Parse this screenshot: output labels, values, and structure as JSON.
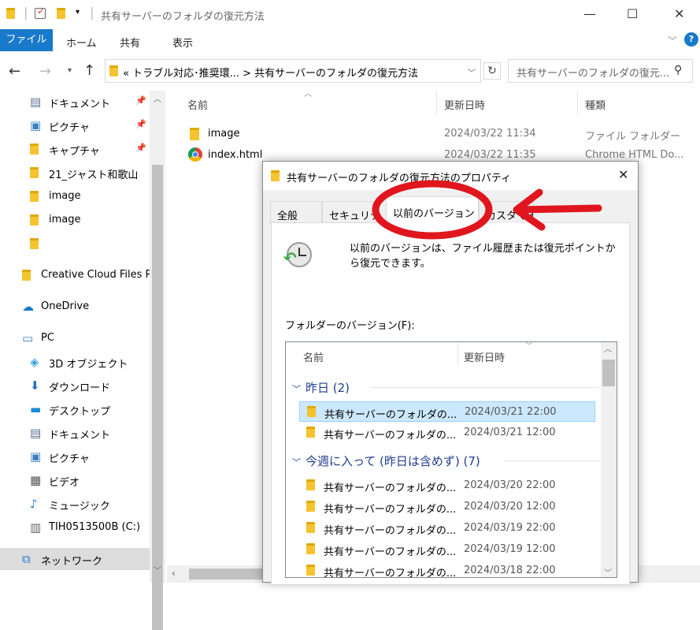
{
  "window": {
    "title": "共有サーバーのフォルダの復元方法",
    "minimize_glyph": "—",
    "maximize_glyph": "☐",
    "close_glyph": "✕"
  },
  "ribbon": {
    "file": "ファイル",
    "tabs": [
      "ホーム",
      "共有",
      "表示"
    ]
  },
  "address": {
    "path": "« トラブル対応･推奨環...  >  共有サーバーのフォルダの復元方法"
  },
  "search": {
    "placeholder": "共有サーバーのフォルダの復元..."
  },
  "sidebar": {
    "items": [
      {
        "label": "ドキュメント",
        "icon": "document-icon",
        "pinned": true
      },
      {
        "label": "ピクチャ",
        "icon": "pictures-icon",
        "pinned": true
      },
      {
        "label": "キャプチャ",
        "icon": "folder-icon",
        "pinned": true
      },
      {
        "label": "21_ジャスト和歌山",
        "icon": "folder-icon"
      },
      {
        "label": "image",
        "icon": "folder-icon"
      },
      {
        "label": "image",
        "icon": "folder-icon"
      },
      {
        "label": "",
        "icon": "folder-icon"
      },
      {
        "label": "Creative Cloud Files P",
        "icon": "folder-icon"
      },
      {
        "label": "OneDrive",
        "icon": "cloud-icon"
      },
      {
        "label": "PC",
        "icon": "pc-icon"
      },
      {
        "label": "3D オブジェクト",
        "icon": "cube-icon"
      },
      {
        "label": "ダウンロード",
        "icon": "download-icon"
      },
      {
        "label": "デスクトップ",
        "icon": "desktop-icon"
      },
      {
        "label": "ドキュメント",
        "icon": "document-icon"
      },
      {
        "label": "ピクチャ",
        "icon": "pictures-icon"
      },
      {
        "label": "ビデオ",
        "icon": "video-icon"
      },
      {
        "label": "ミュージック",
        "icon": "music-icon"
      },
      {
        "label": "TIH0513500B (C:)",
        "icon": "drive-icon"
      },
      {
        "label": "ネットワーク",
        "icon": "network-icon"
      }
    ]
  },
  "filelist": {
    "columns": {
      "name": "名前",
      "date": "更新日時",
      "type": "種類"
    },
    "rows": [
      {
        "name": "image",
        "date": "2024/03/22 11:34",
        "type": "ファイル フォルダー"
      },
      {
        "name": "index.html",
        "date": "2024/03/22 11:35",
        "type": "Chrome HTML Do..."
      }
    ]
  },
  "dialog": {
    "title": "共有サーバーのフォルダの復元方法のプロパティ",
    "tabs": [
      "全般",
      "セキュリティ",
      "以前のバージョン",
      "カスタマイズ"
    ],
    "description": "以前のバージョンは、ファイル履歴または復元ポイントから復元できます。",
    "versions_label": "フォルダーのバージョン(F):",
    "columns": {
      "name": "名前",
      "date": "更新日時"
    },
    "groups": [
      {
        "label": "昨日 (2)",
        "rows": [
          {
            "name": "共有サーバーのフォルダの...",
            "date": "2024/03/21 22:00",
            "selected": true
          },
          {
            "name": "共有サーバーのフォルダの...",
            "date": "2024/03/21 12:00"
          }
        ]
      },
      {
        "label": "今週に入って (昨日は含めず) (7)",
        "rows": [
          {
            "name": "共有サーバーのフォルダの...",
            "date": "2024/03/20 22:00"
          },
          {
            "name": "共有サーバーのフォルダの...",
            "date": "2024/03/20 12:00"
          },
          {
            "name": "共有サーバーのフォルダの...",
            "date": "2024/03/19 22:00"
          },
          {
            "name": "共有サーバーのフォルダの...",
            "date": "2024/03/19 12:00"
          },
          {
            "name": "共有サーバーのフォルダの...",
            "date": "2024/03/18 22:00"
          }
        ]
      }
    ]
  },
  "colors": {
    "annotation_red": "#e0161e",
    "accent": "#1979ca",
    "selection": "#cce8ff"
  }
}
